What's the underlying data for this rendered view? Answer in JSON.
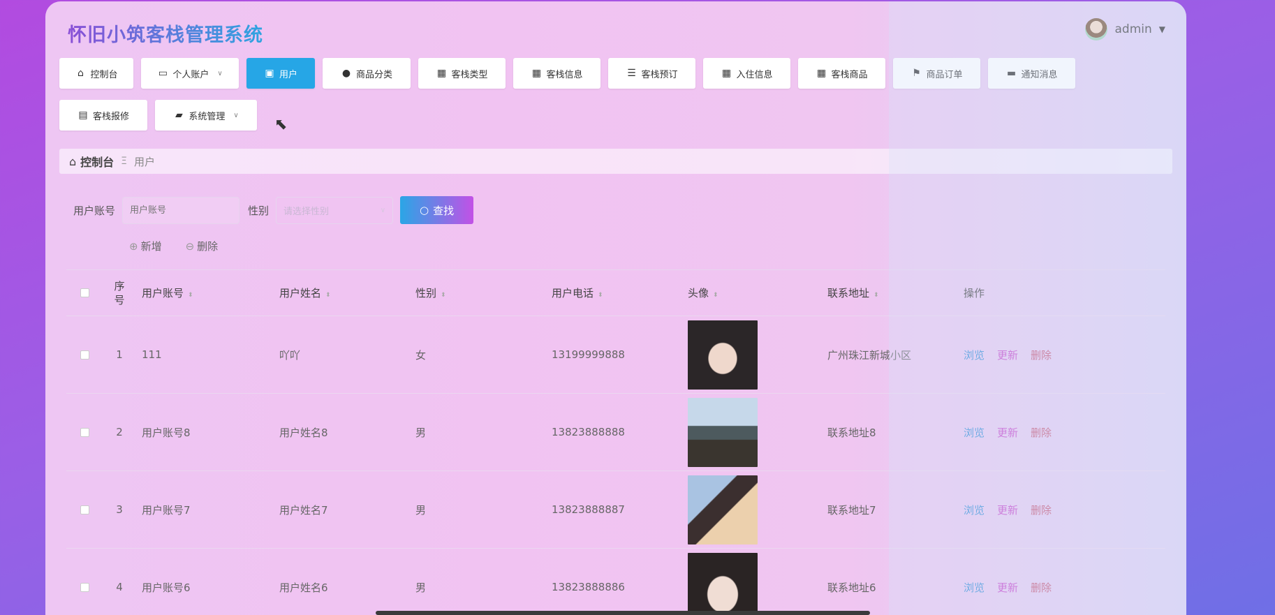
{
  "app": {
    "title": "怀旧小筑客栈管理系统",
    "user": "admin"
  },
  "nav": [
    {
      "label": "控制台",
      "icon": "home-icon",
      "glyph": "⌂"
    },
    {
      "label": "个人账户",
      "icon": "account-icon",
      "glyph": "▭",
      "dropdown": true
    },
    {
      "label": "用户",
      "icon": "clipboard-icon",
      "glyph": "▣",
      "active": true
    },
    {
      "label": "商品分类",
      "icon": "pin-icon",
      "glyph": "●"
    },
    {
      "label": "客栈类型",
      "icon": "grid-icon",
      "glyph": "▦"
    },
    {
      "label": "客栈信息",
      "icon": "grid-icon",
      "glyph": "▦"
    },
    {
      "label": "客栈预订",
      "icon": "list-icon",
      "glyph": "☰"
    },
    {
      "label": "入住信息",
      "icon": "grid-icon",
      "glyph": "▦"
    },
    {
      "label": "客栈商品",
      "icon": "grid-icon",
      "glyph": "▦"
    },
    {
      "label": "商品订单",
      "icon": "flag-icon",
      "glyph": "⚑"
    },
    {
      "label": "通知消息",
      "icon": "monitor-icon",
      "glyph": "▬"
    },
    {
      "label": "客栈报修",
      "icon": "clipboard-icon",
      "glyph": "▤"
    },
    {
      "label": "系统管理",
      "icon": "message-icon",
      "glyph": "▰",
      "dropdown": true
    }
  ],
  "breadcrumb": {
    "home": "控制台",
    "sep": "Ξ",
    "current": "用户"
  },
  "search": {
    "account_label": "用户账号",
    "account_placeholder": "用户账号",
    "sex_label": "性别",
    "sex_placeholder": "请选择性别",
    "button": "查找"
  },
  "actions": {
    "add": "新增",
    "delete": "删除"
  },
  "table": {
    "headers": {
      "index": "序号",
      "account": "用户账号",
      "name": "用户姓名",
      "sex": "性别",
      "phone": "用户电话",
      "avatar": "头像",
      "address": "联系地址",
      "op": "操作"
    },
    "ops": {
      "view": "浏览",
      "update": "更新",
      "delete": "删除"
    },
    "rows": [
      {
        "index": "1",
        "account": "111",
        "name": "吖吖",
        "sex": "女",
        "phone": "13199999888",
        "address": "广州珠江新城小区",
        "photo_colors": [
          "#2b2628",
          "#e9d2c6"
        ]
      },
      {
        "index": "2",
        "account": "用户账号8",
        "name": "用户姓名8",
        "sex": "男",
        "phone": "13823888888",
        "address": "联系地址8",
        "photo_colors": [
          "#bcd2e6",
          "#3c3a36"
        ]
      },
      {
        "index": "3",
        "account": "用户账号7",
        "name": "用户姓名7",
        "sex": "男",
        "phone": "13823888887",
        "address": "联系地址7",
        "photo_colors": [
          "#a6c0e0",
          "#e9c9a4"
        ]
      },
      {
        "index": "4",
        "account": "用户账号6",
        "name": "用户姓名6",
        "sex": "男",
        "phone": "13823888886",
        "address": "联系地址6",
        "photo_colors": [
          "#2a2424",
          "#efdcd3"
        ]
      }
    ]
  }
}
